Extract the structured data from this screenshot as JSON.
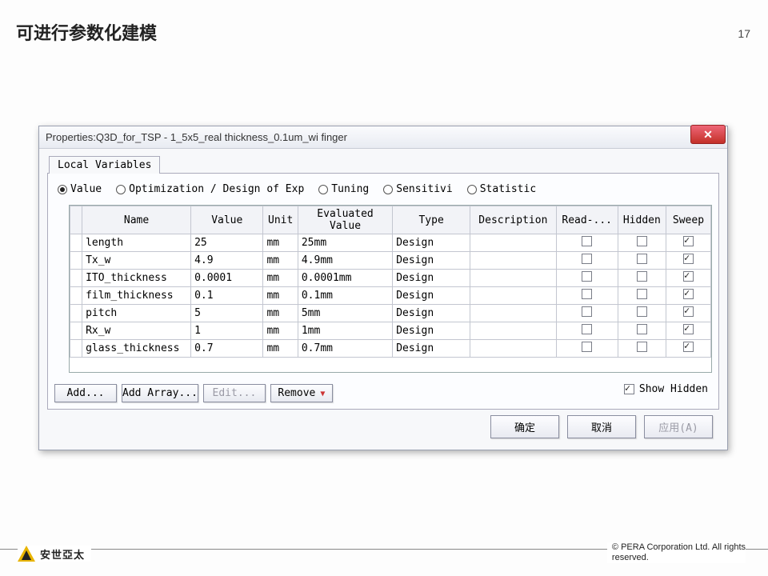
{
  "slide": {
    "title": "可进行参数化建模",
    "page_num": "17"
  },
  "dialog": {
    "title_prefix": "Properties: ",
    "title_name": "Q3D_for_TSP - 1_5x5_real thickness_0.1um_wi finger",
    "tab": "Local Variables",
    "radios": {
      "value": "Value",
      "opt": "Optimization / Design of Exp",
      "tuning": "Tuning",
      "sensitivity": "Sensitivi",
      "statistics": "Statistic",
      "selected": "value"
    },
    "columns": {
      "name": "Name",
      "value": "Value",
      "unit": "Unit",
      "evaluated": "Evaluated Value",
      "type": "Type",
      "description": "Description",
      "readonly": "Read-...",
      "hidden": "Hidden",
      "sweep": "Sweep"
    },
    "rows": [
      {
        "name": "length",
        "value": "25",
        "unit": "mm",
        "evaluated": "25mm",
        "type": "Design",
        "readonly": false,
        "hidden": false,
        "sweep": true
      },
      {
        "name": "Tx_w",
        "value": "4.9",
        "unit": "mm",
        "evaluated": "4.9mm",
        "type": "Design",
        "readonly": false,
        "hidden": false,
        "sweep": true
      },
      {
        "name": "ITO_thickness",
        "value": "0.0001",
        "unit": "mm",
        "evaluated": "0.0001mm",
        "type": "Design",
        "readonly": false,
        "hidden": false,
        "sweep": true
      },
      {
        "name": "film_thickness",
        "value": "0.1",
        "unit": "mm",
        "evaluated": "0.1mm",
        "type": "Design",
        "readonly": false,
        "hidden": false,
        "sweep": true
      },
      {
        "name": "pitch",
        "value": "5",
        "unit": "mm",
        "evaluated": "5mm",
        "type": "Design",
        "readonly": false,
        "hidden": false,
        "sweep": true
      },
      {
        "name": "Rx_w",
        "value": "1",
        "unit": "mm",
        "evaluated": "1mm",
        "type": "Design",
        "readonly": false,
        "hidden": false,
        "sweep": true
      },
      {
        "name": "glass_thickness",
        "value": "0.7",
        "unit": "mm",
        "evaluated": "0.7mm",
        "type": "Design",
        "readonly": false,
        "hidden": false,
        "sweep": true
      }
    ],
    "buttons": {
      "add": "Add...",
      "add_array": "Add Array...",
      "edit": "Edit...",
      "remove": "Remove"
    },
    "show_hidden": {
      "label": "Show Hidden",
      "checked": true
    },
    "dlg_buttons": {
      "ok": "确定",
      "cancel": "取消",
      "apply": "应用(A)"
    }
  },
  "footer": {
    "brand": "安世亞太",
    "copyright_l1": "©  PERA Corporation Ltd. All rights",
    "copyright_l2": "reserved."
  }
}
